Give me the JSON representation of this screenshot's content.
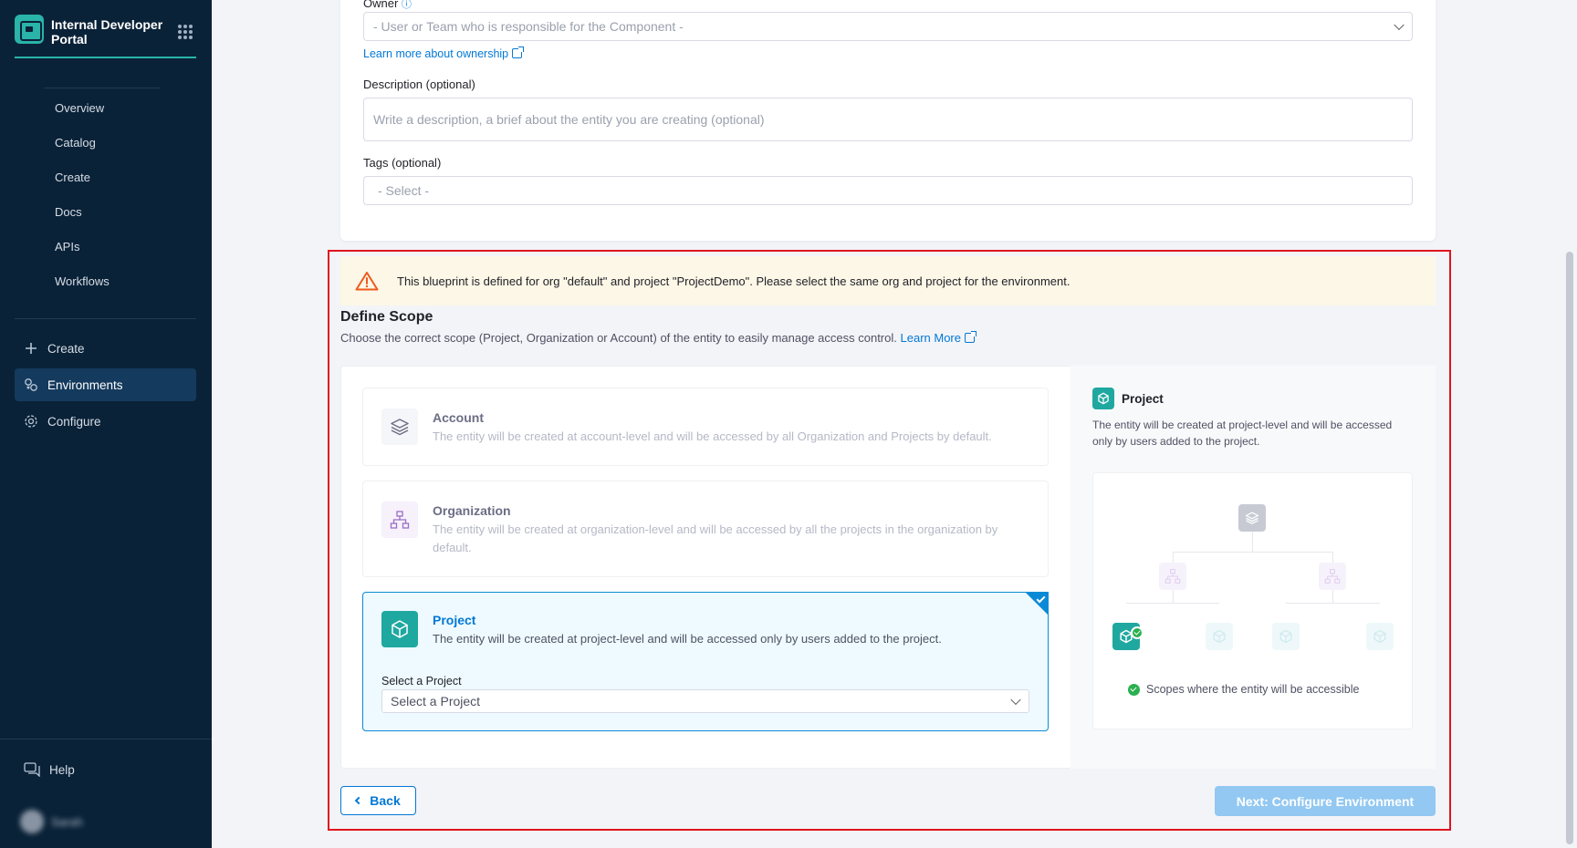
{
  "app": {
    "title": "Internal Developer Portal"
  },
  "sidebar": {
    "sub_items": [
      {
        "label": "Overview"
      },
      {
        "label": "Catalog"
      },
      {
        "label": "Create"
      },
      {
        "label": "Docs"
      },
      {
        "label": "APIs"
      },
      {
        "label": "Workflows"
      }
    ],
    "main_items": [
      {
        "label": "Create",
        "icon": "plus-icon"
      },
      {
        "label": "Environments",
        "icon": "environments-icon",
        "active": true
      },
      {
        "label": "Configure",
        "icon": "gear-icon"
      }
    ],
    "help_label": "Help",
    "user_name": "Sarah"
  },
  "form": {
    "owner_label": "Owner",
    "owner_placeholder": "- User or Team who is responsible for the Component -",
    "ownership_link": "Learn more about ownership",
    "description_label": "Description (optional)",
    "description_placeholder": "Write a description, a brief about the entity you are creating (optional)",
    "tags_label": "Tags (optional)",
    "tags_placeholder": "- Select -"
  },
  "warning": {
    "text": "This blueprint is defined for org \"default\" and project \"ProjectDemo\". Please select the same org and project for the environment."
  },
  "scope": {
    "title": "Define Scope",
    "subtitle": "Choose the correct scope (Project, Organization or Account) of the entity to easily manage access control.",
    "learn_more": "Learn More",
    "options": [
      {
        "title": "Account",
        "description": "The entity will be created at account-level and will be accessed by all Organization and Projects by default.",
        "selected": false
      },
      {
        "title": "Organization",
        "description": "The entity will be created at organization-level and will be accessed by all the projects in the organization by default.",
        "selected": false
      },
      {
        "title": "Project",
        "description": "The entity will be created at project-level and will be accessed only by users added to the project.",
        "selected": true
      }
    ],
    "project_select_label": "Select a Project",
    "project_select_value": "Select a Project",
    "right_panel": {
      "title": "Project",
      "description": "The entity will be created at project-level and will be accessed only by users added to the project.",
      "legend": "Scopes where the entity will be accessible"
    }
  },
  "actions": {
    "back": "Back",
    "next": "Next: Configure Environment"
  },
  "colors": {
    "sidebar_bg": "#0a2238",
    "accent_teal": "#2ab3a8",
    "primary_blue": "#0278d5",
    "highlight_red": "#e0141f",
    "warning_bg": "#fcf7e6"
  }
}
